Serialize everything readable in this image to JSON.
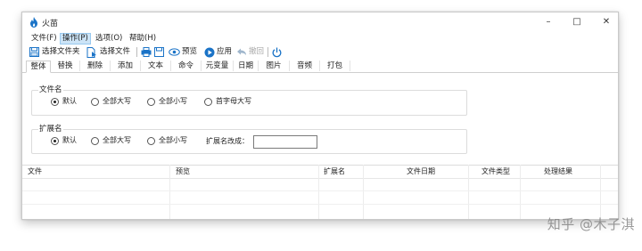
{
  "window": {
    "title": "火苗",
    "controls": {
      "minimize": "–",
      "maximize": "□",
      "close": "✕"
    }
  },
  "menu": [
    {
      "label": "文件(F)"
    },
    {
      "label": "操作(P)",
      "active": true
    },
    {
      "label": "选项(O)"
    },
    {
      "label": "帮助(H)"
    }
  ],
  "toolbar": {
    "select_folder": "选择文件夹",
    "select_file": "选择文件",
    "preview": "预览",
    "apply": "应用",
    "undo": "撤回"
  },
  "tabs": [
    "整体",
    "替换",
    "删除",
    "添加",
    "文本",
    "命令",
    "元变量",
    "日期",
    "图片",
    "音频",
    "打包"
  ],
  "filename_group": {
    "title": "文件名",
    "options": [
      "默认",
      "全部大写",
      "全部小写",
      "首字母大写"
    ],
    "selected": "默认"
  },
  "extension_group": {
    "title": "扩展名",
    "options": [
      "默认",
      "全部大写",
      "全部小写"
    ],
    "selected": "默认",
    "change_to_label": "扩展名改成：",
    "change_to_value": ""
  },
  "table": {
    "columns": [
      "文件",
      "预览",
      "扩展名",
      "文件日期",
      "文件类型",
      "处理结果"
    ]
  },
  "watermark": "知乎 @木子淇",
  "colors": {
    "menu_active_bg": "#cce4f7",
    "accent_blue": "#1a73c7"
  }
}
